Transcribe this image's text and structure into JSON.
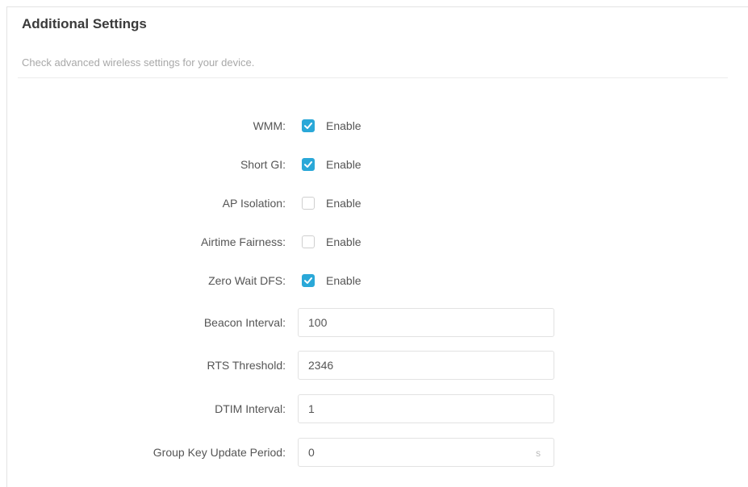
{
  "section": {
    "title": "Additional Settings",
    "subtitle": "Check advanced wireless settings for your device."
  },
  "checkboxes": [
    {
      "label": "WMM:",
      "text": "Enable",
      "checked": true
    },
    {
      "label": "Short GI:",
      "text": "Enable",
      "checked": true
    },
    {
      "label": "AP Isolation:",
      "text": "Enable",
      "checked": false
    },
    {
      "label": "Airtime Fairness:",
      "text": "Enable",
      "checked": false
    },
    {
      "label": "Zero Wait DFS:",
      "text": "Enable",
      "checked": true
    }
  ],
  "fields": [
    {
      "label": "Beacon Interval:",
      "value": "100",
      "unit": ""
    },
    {
      "label": "RTS Threshold:",
      "value": "2346",
      "unit": ""
    },
    {
      "label": "DTIM Interval:",
      "value": "1",
      "unit": ""
    },
    {
      "label": "Group Key Update Period:",
      "value": "0",
      "unit": "s"
    }
  ],
  "colors": {
    "accent": "#2aa8d8"
  }
}
